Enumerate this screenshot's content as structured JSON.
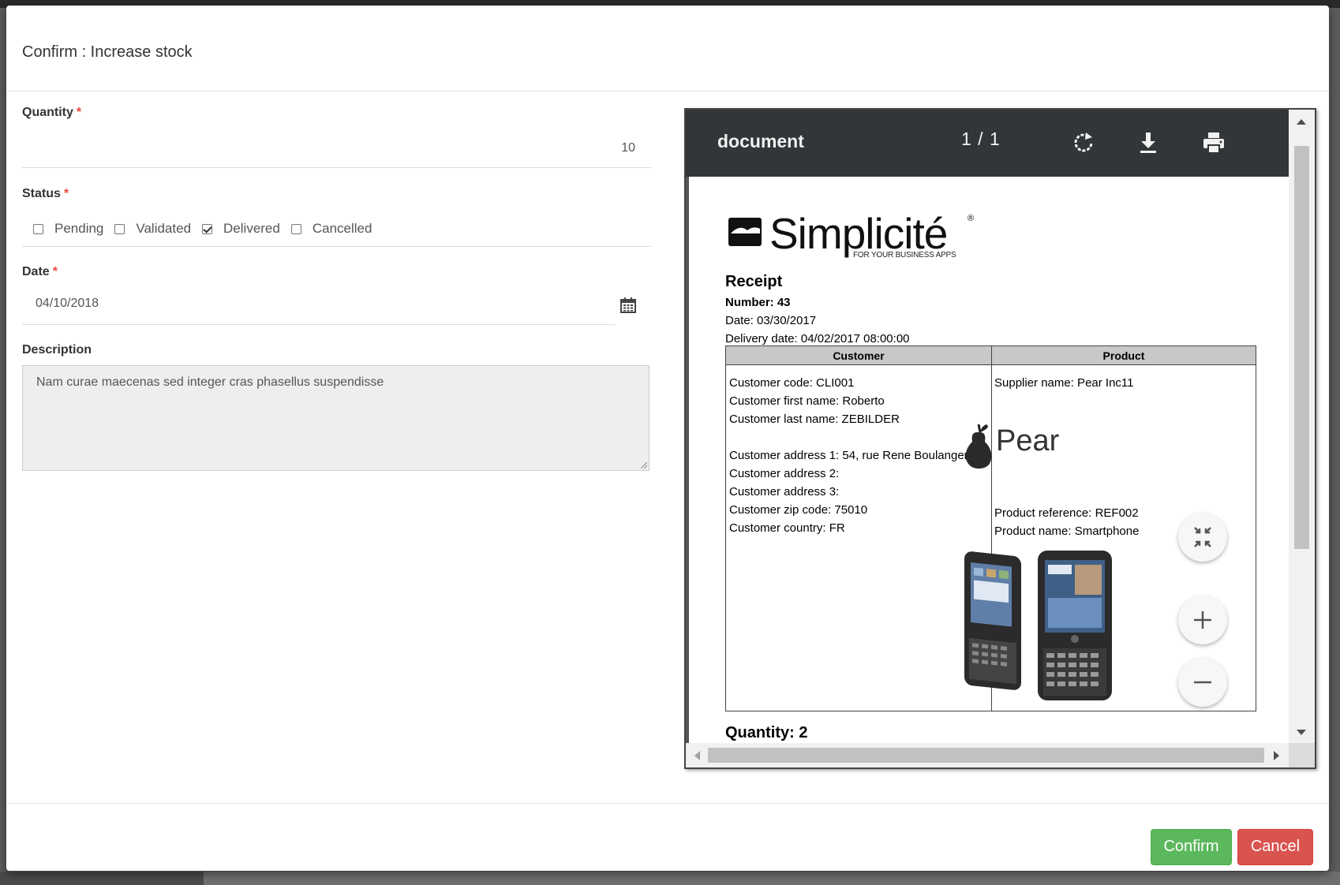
{
  "modal": {
    "title": "Confirm : Increase stock"
  },
  "form": {
    "quantity": {
      "label": "Quantity",
      "required_mark": "*",
      "value": "10"
    },
    "status": {
      "label": "Status",
      "required_mark": "*",
      "options": [
        {
          "label": "Pending",
          "checked": false
        },
        {
          "label": "Validated",
          "checked": false
        },
        {
          "label": "Delivered",
          "checked": true
        },
        {
          "label": "Cancelled",
          "checked": false
        }
      ]
    },
    "date": {
      "label": "Date",
      "required_mark": "*",
      "value": "04/10/2018",
      "icon": "calendar-icon"
    },
    "description": {
      "label": "Description",
      "value": "Nam curae maecenas sed integer cras phasellus suspendisse"
    }
  },
  "pdf_viewer": {
    "title": "document",
    "page_indicator": "1 / 1",
    "icons": [
      "rotate-icon",
      "download-icon",
      "print-icon",
      "fit-page-icon",
      "zoom-in-icon",
      "zoom-out-icon"
    ]
  },
  "document": {
    "logo_text": "Simplicité",
    "logo_tagline": "FOR YOUR BUSINESS APPS",
    "logo_reg": "®",
    "heading": "Receipt",
    "number": "Number: 43",
    "date": "Date: 03/30/2017",
    "delivery_date": "Delivery date: 04/02/2017 08:00:00",
    "table": {
      "headers": [
        "Customer",
        "Product"
      ],
      "customer_lines": [
        "Customer code: CLI001",
        "Customer first name: Roberto",
        "Customer last name: ZEBILDER",
        "",
        "Customer address 1: 54, rue Rene Boulanger",
        "Customer address 2:",
        "Customer address 3:",
        "Customer zip code: 75010",
        "Customer country: FR"
      ],
      "supplier": "Supplier name: Pear Inc11",
      "supplier_logo_text": "Pear",
      "product_reference": "Product reference: REF002",
      "product_name": "Product name: Smartphone"
    },
    "quantity_partial": "Quantity: 2"
  },
  "footer": {
    "confirm_label": "Confirm",
    "cancel_label": "Cancel"
  },
  "colors": {
    "confirm": "#5cb85c",
    "cancel": "#d9534f",
    "toolbar": "#323639",
    "required": "#e74c3c"
  }
}
